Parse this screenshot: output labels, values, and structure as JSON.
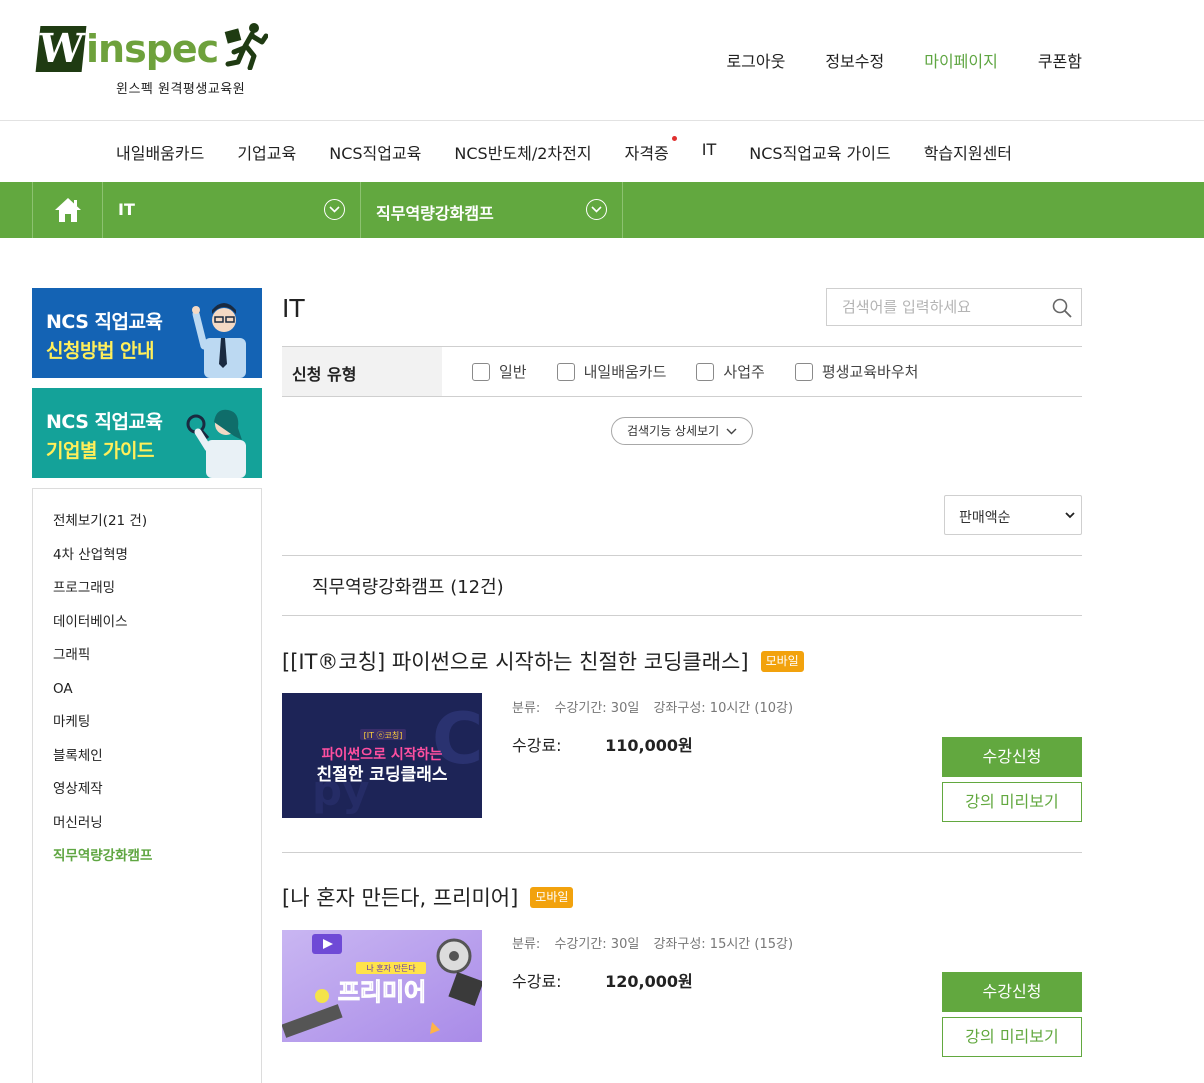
{
  "brand": {
    "logo_letter": "W",
    "logo_rest": "inspec",
    "subtitle": "윈스펙 원격평생교육원",
    "accent": "#62a83f",
    "dark": "#1f3b12"
  },
  "util_nav": [
    "로그아웃",
    "정보수정",
    "마이페이지",
    "쿠폰함"
  ],
  "util_active": "마이페이지",
  "gnb": [
    "내일배움카드",
    "기업교육",
    "NCS직업교육",
    "NCS반도체/2차전지",
    "자격증",
    "IT",
    "NCS직업교육 가이드",
    "학습지원센터"
  ],
  "location": {
    "home_icon": "home-icon",
    "level1": "IT",
    "level2": "직무역량강화캠프"
  },
  "banners": [
    {
      "line1": "NCS 직업교육",
      "line2": "신청방법 안내",
      "color": "#1463b4"
    },
    {
      "line1": "NCS 직업교육",
      "line2": "기업별 가이드",
      "color": "#14a299"
    }
  ],
  "categories": [
    "전체보기(21 건)",
    "4차 산업혁명",
    "프로그래밍",
    "데이터베이스",
    "그래픽",
    "OA",
    "마케팅",
    "블록체인",
    "영상제작",
    "머신러닝",
    "직무역량강화캠프"
  ],
  "category_selected": "직무역량강화캠프",
  "page_title": "IT",
  "search": {
    "placeholder": "검색어를 입력하세요",
    "value": ""
  },
  "filter": {
    "label": "신청 유형",
    "options": [
      "일반",
      "내일배움카드",
      "사업주",
      "평생교육바우처"
    ]
  },
  "detail_search_label": "검색기능 상세보기",
  "sort": {
    "selected": "판매액순"
  },
  "group_title": "직무역량강화캠프 (12건)",
  "courses": [
    {
      "title": "[[IT®코칭] 파이썬으로 시작하는 친절한 코딩클래스]",
      "badge": "모바일",
      "meta_label": "분류:",
      "duration": "수강기간: 30일",
      "composition": "강좌구성: 10시간 (10강)",
      "price_label": "수강료:",
      "price": "110,000원",
      "apply": "수강신청",
      "preview": "강의 미리보기",
      "thumb_tag": "[IT ⓔ코칭]",
      "thumb_line1": "파이썬으로 시작하는",
      "thumb_line2": "친절한 코딩클래스"
    },
    {
      "title": "[나 혼자 만든다, 프리미어]",
      "badge": "모바일",
      "meta_label": "분류:",
      "duration": "수강기간: 30일",
      "composition": "강좌구성: 15시간 (15강)",
      "price_label": "수강료:",
      "price": "120,000원",
      "apply": "수강신청",
      "preview": "강의 미리보기",
      "thumb_tag": "나 혼자 만든다",
      "thumb_line1": "프리미어"
    }
  ]
}
